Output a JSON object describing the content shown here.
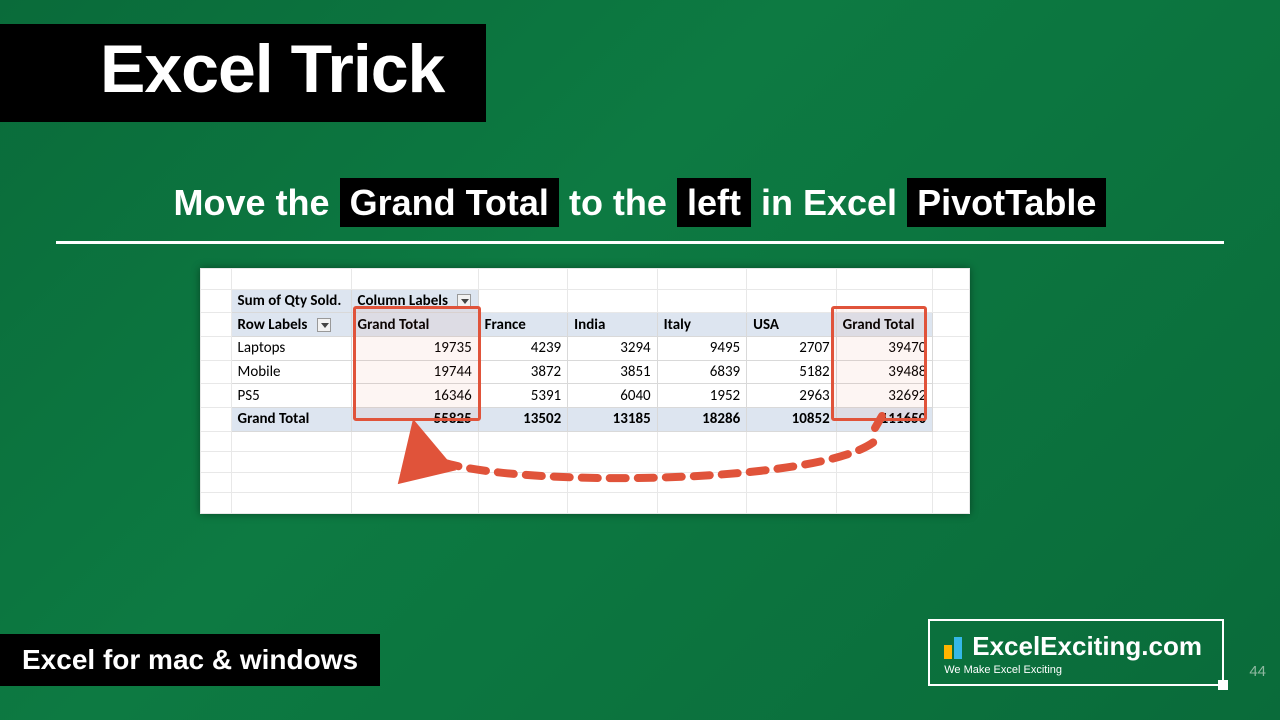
{
  "title": "Excel Trick",
  "subtitle": {
    "t1": "Move the",
    "p1": "Grand Total",
    "t2": "to the",
    "p2": "left",
    "t3": "in Excel",
    "p3": "PivotTable"
  },
  "pivot": {
    "measure_label": "Sum of Qty Sold.",
    "col_labels_tag": "Column Labels",
    "row_labels_tag": "Row Labels",
    "gt_label": "Grand Total",
    "columns": [
      "France",
      "India",
      "Italy",
      "USA"
    ],
    "rows": [
      {
        "label": "Laptops",
        "gtl": 19735,
        "vals": [
          4239,
          3294,
          9495,
          2707
        ],
        "gtr": 39470
      },
      {
        "label": "Mobile",
        "gtl": 19744,
        "vals": [
          3872,
          3851,
          6839,
          5182
        ],
        "gtr": 39488
      },
      {
        "label": "PS5",
        "gtl": 16346,
        "vals": [
          5391,
          6040,
          1952,
          2963
        ],
        "gtr": 32692
      }
    ],
    "totals": {
      "gtl": 55825,
      "vals": [
        13502,
        13185,
        18286,
        10852
      ],
      "gtr": 111650
    }
  },
  "bottom_left": "Excel for mac & windows",
  "brand": {
    "name": "ExcelExciting.com",
    "tag": "We Make Excel Exciting"
  },
  "page_num": "44"
}
